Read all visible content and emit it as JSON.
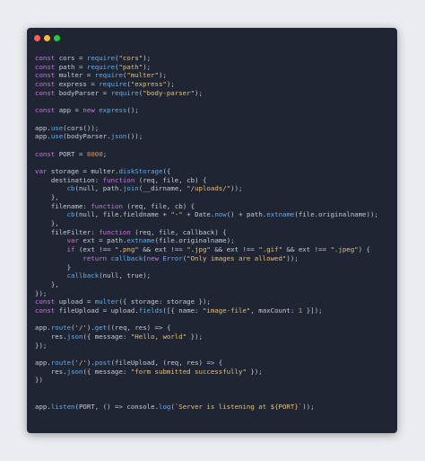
{
  "window": {
    "traffic_lights": [
      "#ff5f57",
      "#febc2e",
      "#28c840"
    ]
  },
  "syntax_colors": {
    "keyword": "#c678dd",
    "function": "#61afef",
    "string": "#e5c07b",
    "number": "#d19a66",
    "text": "#c7cbd6",
    "background": "#1f2532"
  },
  "code_lines": [
    "const cors = require(\"cors\");",
    "const path = require(\"path\");",
    "const multer = require(\"multer\");",
    "const express = require(\"express\");",
    "const bodyParser = require(\"body-parser\");",
    "",
    "const app = new express();",
    "",
    "app.use(cors());",
    "app.use(bodyParser.json());",
    "",
    "const PORT = 8000;",
    "",
    "var storage = multer.diskStorage({",
    "    destination: function (req, file, cb) {",
    "        cb(null, path.join(__dirname, \"/uploads/\"));",
    "    },",
    "    filename: function (req, file, cb) {",
    "        cb(null, file.fieldname + \"-\" + Date.now() + path.extname(file.originalname));",
    "    },",
    "    fileFilter: function (req, file, callback) {",
    "        var ext = path.extname(file.originalname);",
    "        if (ext !== \".png\" && ext !== \".jpg\" && ext !== \".gif\" && ext !== \".jpeg\") {",
    "            return callback(new Error(\"Only images are allowed\"));",
    "        }",
    "        callback(null, true);",
    "    },",
    "});",
    "const upload = multer({ storage: storage });",
    "const fileUpload = upload.fields([{ name: \"image-file\", maxCount: 1 }]);",
    "",
    "app.route('/').get((req, res) => {",
    "    res.json({ message: \"Hello, world\" });",
    "});",
    "",
    "app.route('/').post(fileUpload, (req, res) => {",
    "    res.json({ message: \"form submitted successfully\" });",
    "})",
    "",
    "",
    "app.listen(PORT, () => console.log(`Server is listening at ${PORT}`));"
  ]
}
